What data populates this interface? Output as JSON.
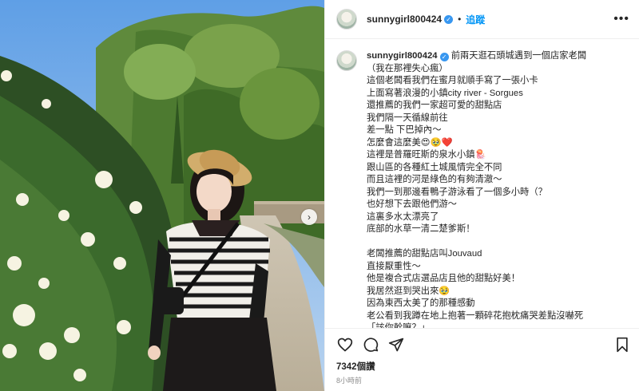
{
  "post": {
    "username": "sunnygirl800424",
    "follow_label": "追蹤",
    "separator": "•",
    "more_label": "•••",
    "caption": "前兩天逛石頭城遇到一個店家老闆\n（我在那裡失心瘋）\n這個老闆看我們在蜜月就順手寫了一張小卡\n上面寫著浪漫的小鎮city river - Sorgues\n還推薦的我們一家超可愛的甜點店\n我們隔一天循線前往\n差一點 下巴掉內～\n怎麼會這麼美😍🥹❤️\n這裡是普羅旺斯的泉水小鎮🪼\n跟山區的各種紅土城風情完全不同\n而且這裡的河是綠色的有夠清澈～\n我們一到那邊看鴨子游泳看了一個多小時（？\n也好想下去跟他們游～\n這裏多水太漂亮了\n底部的水草一清二楚爹斯！\n\n老闆推薦的甜點店叫Jouvaud\n直接厭重性～\n他是複合式店選品店且他的甜點好美！\n我居然逛到哭出來🥹\n因為東西太美了的那種感動\n老公看到我蹲在地上抱著一顆碎花抱枕痛哭差點沒嚇死\n「該你幹嘛？」\n「這…太美了…🥹",
    "likes": "7342個讚",
    "time": "8小時前"
  },
  "icons": {
    "like": "heart-icon",
    "comment": "comment-icon",
    "share": "share-icon",
    "save": "bookmark-icon",
    "next": "chevron-right-icon",
    "verified": "verified-badge-icon"
  },
  "colors": {
    "link_blue": "#0095f6",
    "verified_blue": "#3897f0",
    "muted": "#8e8e8e",
    "text": "#262626"
  }
}
